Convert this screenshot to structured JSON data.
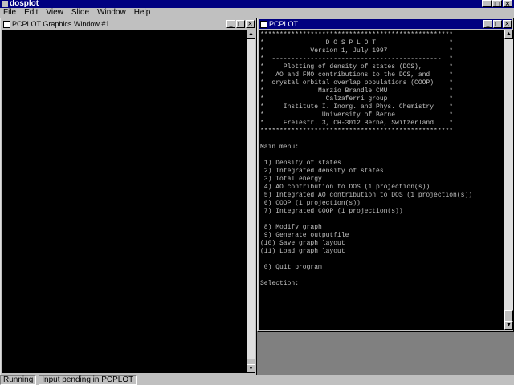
{
  "app": {
    "title": "dosplot"
  },
  "menu": [
    "File",
    "Edit",
    "View",
    "Slide",
    "Window",
    "Help"
  ],
  "graphics_window": {
    "title": "PCPLOT Graphics Window #1"
  },
  "console_window": {
    "title": "PCPLOT",
    "lines": [
      "**************************************************",
      "*                D O S P L O T                   *",
      "*            Version 1, July 1997                *",
      "*  --------------------------------------------  *",
      "*     Plotting of density of states (DOS),       *",
      "*   AO and FMO contributions to the DOS, and     *",
      "*  crystal orbital overlap populations (COOP)    *",
      "*              Marzio Brandle CMU                *",
      "*                Calzaferri group                *",
      "*     Institute I. Inorg. and Phys. Chemistry    *",
      "*               University of Berne              *",
      "*     Freiestr. 3, CH-3012 Berne, Switzerland    *",
      "**************************************************",
      "",
      "Main menu:",
      "",
      " 1) Density of states",
      " 2) Integrated density of states",
      " 3) Total energy",
      " 4) AO contribution to DOS (1 projection(s))",
      " 5) Integrated AO contribution to DOS (1 projection(s))",
      " 6) COOP (1 projection(s))",
      " 7) Integrated COOP (1 projection(s))",
      "",
      " 8) Modify graph",
      " 9) Generate outputfile",
      "(10) Save graph layout",
      "(11) Load graph layout",
      "",
      " 0) Quit program",
      "",
      "Selection:"
    ]
  },
  "status": [
    "Running",
    "Input pending in PCPLOT"
  ]
}
